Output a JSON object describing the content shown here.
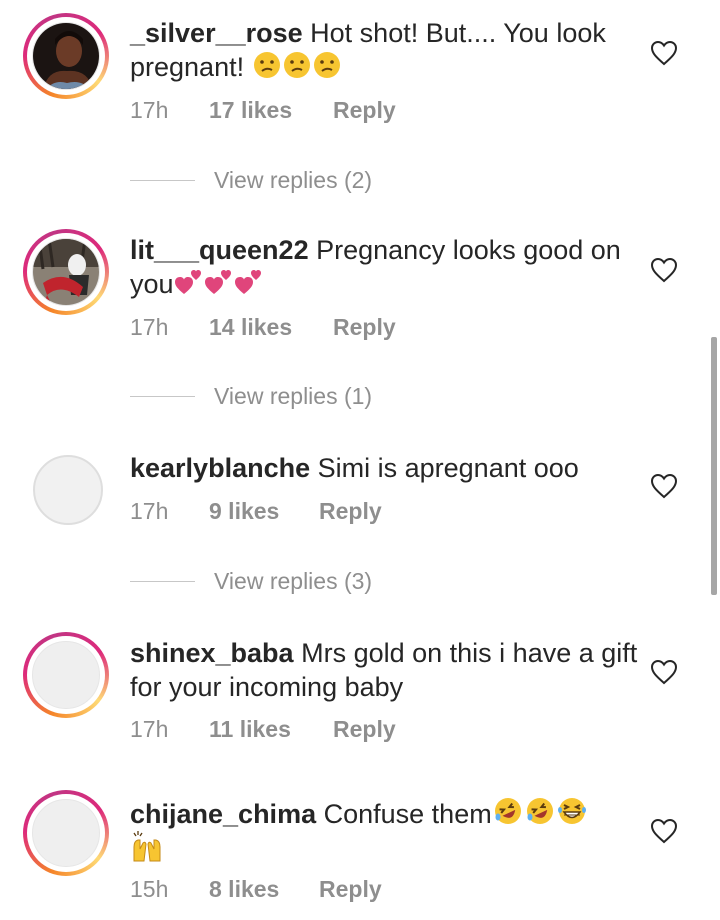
{
  "comments": [
    {
      "username": "_silver__rose",
      "text": "Hot shot! But.... You look pregnant!",
      "emojis": [
        "confused-face-icon",
        "confused-face-icon",
        "confused-face-icon"
      ],
      "time": "17h",
      "likes": "17 likes",
      "reply": "Reply",
      "view_replies": "View replies (2)",
      "avatar": "photo-story-ring"
    },
    {
      "username": "lit___queen22",
      "text": "Pregnancy looks good on you",
      "emojis": [
        "two-hearts-icon",
        "two-hearts-icon",
        "two-hearts-icon"
      ],
      "time": "17h",
      "likes": "14 likes",
      "reply": "Reply",
      "view_replies": "View replies (1)",
      "avatar": "photo-story-ring"
    },
    {
      "username": "kearlyblanche",
      "text": "Simi is apregnant ooo",
      "emojis": [],
      "time": "17h",
      "likes": "9 likes",
      "reply": "Reply",
      "view_replies": "View replies (3)",
      "avatar": "default"
    },
    {
      "username": "shinex_baba",
      "text": "Mrs gold on this i have a gift for your incoming baby",
      "emojis": [],
      "time": "17h",
      "likes": "11 likes",
      "reply": "Reply",
      "avatar": "default-story-ring"
    },
    {
      "username": "chijane_chima",
      "text": "Confuse them",
      "emojis": [
        "rolling-laughing-icon",
        "rolling-laughing-icon",
        "grinning-squint-icon",
        "raising-hands-icon"
      ],
      "time": "15h",
      "likes": "8 likes",
      "reply": "Reply",
      "avatar": "default-story-ring"
    }
  ],
  "colors": {
    "meta_text": "#8e8e8e",
    "primary_text": "#262626",
    "story_ring": [
      "#f58529",
      "#dd2a7b",
      "#feda75"
    ],
    "heart_emoji": "#e0457b",
    "emoji_yellow": "#f7c531"
  }
}
